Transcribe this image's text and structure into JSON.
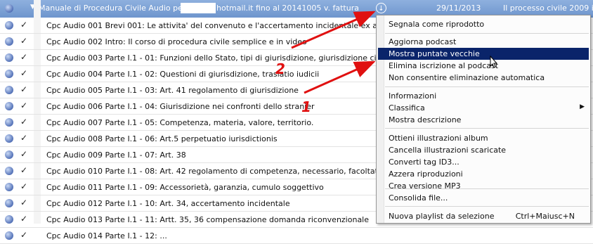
{
  "podcast": {
    "title": "Manuale di Procedura Civile Audio per",
    "email_suffix": "hotmail.it fino al 20141005 v. fattura",
    "date": "29/11/2013",
    "description": "Il processo civile 2009 in"
  },
  "episodes": [
    {
      "title": "Cpc Audio 001 Brevi  001: Le attivita' del convenuto e l'accertamento incidentale ex artico"
    },
    {
      "title": "Cpc Audio 002 Intro: Il corso di procedura civile semplice e in video"
    },
    {
      "title": "Cpc Audio 003 Parte I.1 - 01: Funzioni dello Stato, tipi di giurisdizione, giurisdizione ci..."
    },
    {
      "title": "Cpc Audio 004 Parte I.1 - 02: Questioni di giurisdizione, traslatio iudicii"
    },
    {
      "title": "Cpc Audio 005 Parte I.1 - 03: Art. 41 regolamento di giurisdizione"
    },
    {
      "title": "Cpc Audio 006 Parte I.1 - 04: Giurisdizione nei confronti dello stranier"
    },
    {
      "title": "Cpc Audio 007 Parte I.1 - 05: Competenza, materia, valore, territorio."
    },
    {
      "title": "Cpc Audio 008 Parte I.1 - 06: Art.5 perpetuatio iurisdictionis"
    },
    {
      "title": "Cpc Audio 009 Parte I.1 - 07: Art. 38"
    },
    {
      "title": "Cpc Audio 010 Parte I.1 - 08: Art. 42 regolamento di competenza, necessario, facoltati..."
    },
    {
      "title": "Cpc Audio 011 Parte I.1 - 09: Accessorietà, garanzia, cumulo soggettivo"
    },
    {
      "title": "Cpc Audio 012 Parte I.1 - 10: Art. 34, accertamento incidentale"
    },
    {
      "title": "Cpc Audio 013 Parte I.1 - 11: Artt. 35, 36 compensazione domanda riconvenzionale"
    },
    {
      "title": "Cpc Audio 014 Parte I.1 - 12: ..."
    }
  ],
  "context_menu": {
    "items": [
      {
        "label": "Segnala come riprodotto"
      },
      {
        "label": "Aggiorna podcast"
      },
      {
        "label": "Mostra puntate vecchie"
      },
      {
        "label": "Elimina iscrizione al podcast"
      },
      {
        "label": "Non consentire eliminazione automatica"
      },
      {
        "label": "Informazioni"
      },
      {
        "label": "Classifica"
      },
      {
        "label": "Mostra descrizione"
      },
      {
        "label": "Ottieni illustrazioni album"
      },
      {
        "label": "Cancella illustrazioni scaricate"
      },
      {
        "label": "Converti tag ID3..."
      },
      {
        "label": "Azzera riproduzioni"
      },
      {
        "label": "Crea versione MP3"
      },
      {
        "label": "Consolida file..."
      },
      {
        "label": "Nuova playlist da selezione",
        "shortcut": "Ctrl+Maiusc+N"
      }
    ],
    "highlighted_label": "Mostra puntate vecchie"
  },
  "annotations": {
    "label_1": "1",
    "label_2": "2"
  },
  "colors": {
    "header_bg": "#7a9fd4",
    "menu_highlight": "#0a246a",
    "arrow": "#e01010"
  },
  "icons": [
    "row-status-dot-icon",
    "checkmark-icon",
    "disclosure-triangle-icon",
    "download-icon",
    "submenu-arrow-icon",
    "mouse-cursor-icon"
  ]
}
